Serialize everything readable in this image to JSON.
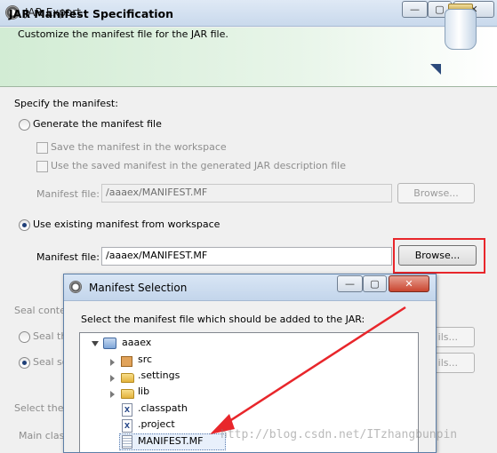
{
  "window": {
    "title": "JAR Export",
    "controls": {
      "minimize": "—",
      "maximize": "▢",
      "close": "✕"
    }
  },
  "banner": {
    "title": "JAR Manifest Specification",
    "description": "Customize the manifest file for the JAR file."
  },
  "manifest_section": {
    "heading": "Specify the manifest:",
    "generate_option": "Generate the manifest file",
    "save_option": "Save the manifest in the workspace",
    "reuse_option": "Use the saved manifest in the generated JAR description file",
    "generated_field_label": "Manifest file:",
    "generated_field_value": "/aaaex/MANIFEST.MF",
    "generated_browse": "Browse...",
    "existing_option": "Use existing manifest from workspace",
    "existing_field_label": "Manifest file:",
    "existing_field_value": "/aaaex/MANIFEST.MF",
    "existing_browse": "Browse..."
  },
  "partial_background": {
    "seal_heading": "Seal conte",
    "seal_option_1": "Seal th",
    "seal_option_2": "Seal so",
    "details_1": "ils...",
    "details_2": "ils...",
    "select_heading": "Select the",
    "main_class": "Main clas"
  },
  "dialog": {
    "title": "Manifest Selection",
    "controls": {
      "minimize": "—",
      "maximize": "▢",
      "close": "✕"
    },
    "instruction": "Select the manifest file which should be added to the JAR:",
    "tree": [
      {
        "label": "aaaex",
        "kind": "project",
        "expanded": true,
        "icon": "project-icon"
      },
      {
        "label": "src",
        "kind": "package-folder",
        "expanded": false,
        "icon": "package-folder-icon"
      },
      {
        "label": ".settings",
        "kind": "folder",
        "expanded": false,
        "icon": "folder-icon"
      },
      {
        "label": "lib",
        "kind": "folder",
        "expanded": false,
        "icon": "folder-icon"
      },
      {
        "label": ".classpath",
        "kind": "xml-file",
        "icon": "xml-file-icon"
      },
      {
        "label": ".project",
        "kind": "xml-file",
        "icon": "xml-file-icon"
      },
      {
        "label": "MANIFEST.MF",
        "kind": "file",
        "selected": true,
        "icon": "text-file-icon"
      }
    ]
  },
  "annotation": {
    "arrow_color": "#e8262b",
    "highlight_color": "#e8262b"
  },
  "watermark": "http://blog.csdn.net/ITzhangbunpin"
}
